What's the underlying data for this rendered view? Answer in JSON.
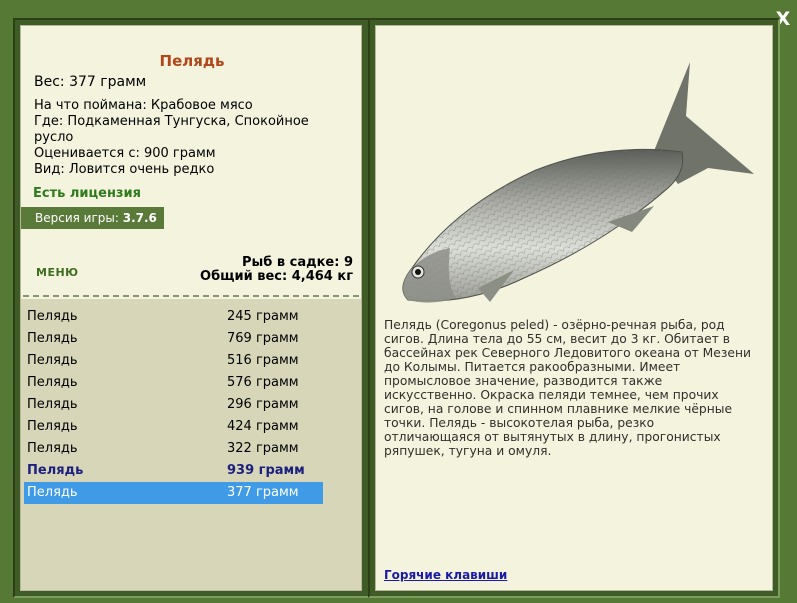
{
  "window": {
    "close_glyph": "X"
  },
  "fish": {
    "title": "Пелядь",
    "weight_label": "Вес:",
    "weight_value": "377 грамм",
    "caught_on": "На что поймана: Крабовое мясо",
    "where": "Где: Подкаменная Тунгуска, Спокойное русло",
    "valued_from": "Оценивается с: 900 грамм",
    "kind": "Вид: Ловится очень редко"
  },
  "license": "Есть лицензия",
  "version": {
    "label": "Версия игры:",
    "value": "3.7.6"
  },
  "menu_label": "МЕНЮ",
  "stats": {
    "count": "Рыб в садке: 9",
    "total_weight": "Общий вес: 4,464 кг"
  },
  "catch_list": [
    {
      "name": "Пелядь",
      "weight": "245 грамм"
    },
    {
      "name": "Пелядь",
      "weight": "769 грамм"
    },
    {
      "name": "Пелядь",
      "weight": "516 грамм"
    },
    {
      "name": "Пелядь",
      "weight": "576 грамм"
    },
    {
      "name": "Пелядь",
      "weight": "296 грамм"
    },
    {
      "name": "Пелядь",
      "weight": "424 грамм"
    },
    {
      "name": "Пелядь",
      "weight": "322 грамм"
    },
    {
      "name": "Пелядь",
      "weight": "939 грамм"
    },
    {
      "name": "Пелядь",
      "weight": "377 грамм"
    }
  ],
  "description": "Пелядь (Coregonus peled) - озёрно-речная рыба, род сигов. Длина тела до 55 см, весит до 3 кг. Обитает в бассейнах рек Северного Ледовитого океана от Мезени до Колымы. Питается ракообразными. Имеет промысловое значение, разводится также искусственно. Окраска пеляди темнее, чем прочих сигов, на голове и спинном плавнике мелкие чёрные точки. Пелядь - высокотелая рыба, резко отличающаяся от вытянутых в длину, прогонистых ряпушек, тугуна и омуля.",
  "hotkeys_link": "Горячие клавиши",
  "colors": {
    "background": "#567a35",
    "panel": "#f4f3de",
    "list_bg": "#d7d6b9",
    "title": "#b0461a",
    "license": "#2e7a1c",
    "selected_row": "#3f9be6",
    "best_row": "#1b1f7e",
    "link": "#1a1aa8"
  },
  "icons": {
    "close": "close-icon",
    "fish": "fish-image"
  }
}
